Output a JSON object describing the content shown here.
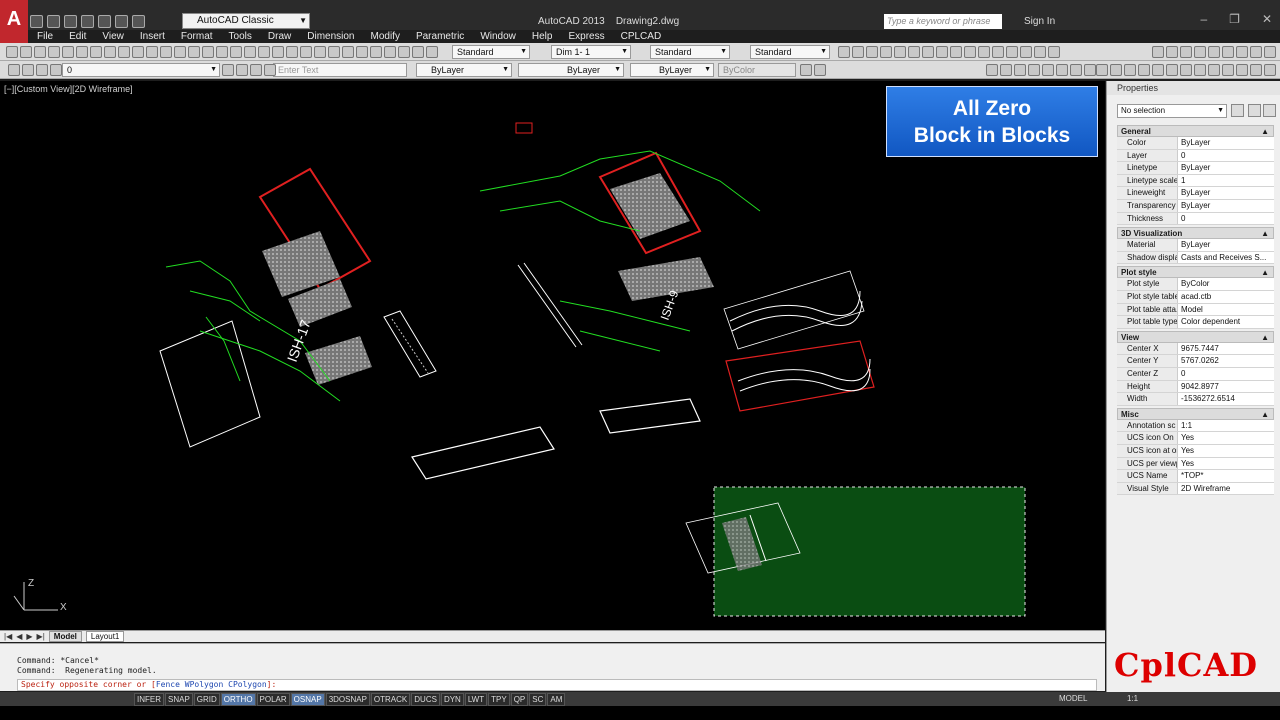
{
  "app": {
    "title": "AutoCAD 2013    Drawing2.dwg",
    "workspace": "AutoCAD Classic",
    "search_placeholder": "Type a keyword or phrase",
    "signin": "Sign In",
    "logo_letter": "A"
  },
  "menu": [
    "File",
    "Edit",
    "View",
    "Insert",
    "Format",
    "Tools",
    "Draw",
    "Dimension",
    "Modify",
    "Parametric",
    "Window",
    "Help",
    "Express",
    "CPLCAD"
  ],
  "toolbar": {
    "text_style": "Standard",
    "dim_style": "Dim 1- 1",
    "table_style": "Standard",
    "multileader_style": "Standard",
    "layer": "0",
    "enter_text_placeholder": "Enter Text",
    "color": "ByLayer",
    "linetype": "ByLayer",
    "lineweight": "ByLayer",
    "plotstyle": "ByColor"
  },
  "viewport": {
    "label": "[−][Custom View][2D Wireframe]",
    "banner_line1": "All Zero",
    "banner_line2": "Block in Blocks"
  },
  "layout_tabs": [
    "Model",
    "Layout1"
  ],
  "command": {
    "history": [
      "Command: *Cancel*",
      "Command:  Regenerating model."
    ],
    "prompt_prefix": "Specify opposite corner or [",
    "prompt_fence": "Fence",
    "prompt_wpolygon": "WPolygon",
    "prompt_cpolygon": "CPolygon",
    "prompt_suffix": "]:"
  },
  "statusbar": {
    "toggles": [
      {
        "label": "INFER",
        "on": false
      },
      {
        "label": "SNAP",
        "on": false
      },
      {
        "label": "GRID",
        "on": false
      },
      {
        "label": "ORTHO",
        "on": true
      },
      {
        "label": "POLAR",
        "on": false
      },
      {
        "label": "OSNAP",
        "on": true
      },
      {
        "label": "3DOSNAP",
        "on": false
      },
      {
        "label": "OTRACK",
        "on": false
      },
      {
        "label": "DUCS",
        "on": false
      },
      {
        "label": "DYN",
        "on": false
      },
      {
        "label": "LWT",
        "on": false
      },
      {
        "label": "TPY",
        "on": false
      },
      {
        "label": "QP",
        "on": false
      },
      {
        "label": "SC",
        "on": false
      },
      {
        "label": "AM",
        "on": false
      }
    ],
    "model": "MODEL",
    "scale": "1:1"
  },
  "properties": {
    "title": "Properties",
    "selection": "No selection",
    "sections": [
      {
        "name": "General",
        "rows": [
          [
            "Color",
            "ByLayer"
          ],
          [
            "Layer",
            "0"
          ],
          [
            "Linetype",
            "ByLayer"
          ],
          [
            "Linetype scale",
            "1"
          ],
          [
            "Lineweight",
            "ByLayer"
          ],
          [
            "Transparency",
            "ByLayer"
          ],
          [
            "Thickness",
            "0"
          ]
        ]
      },
      {
        "name": "3D Visualization",
        "rows": [
          [
            "Material",
            "ByLayer"
          ],
          [
            "Shadow display",
            "Casts and Receives S..."
          ]
        ]
      },
      {
        "name": "Plot style",
        "rows": [
          [
            "Plot style",
            "ByColor"
          ],
          [
            "Plot style table",
            "acad.ctb"
          ],
          [
            "Plot table atta...",
            "Model"
          ],
          [
            "Plot table type",
            "Color dependent"
          ]
        ]
      },
      {
        "name": "View",
        "rows": [
          [
            "Center X",
            "9675.7447"
          ],
          [
            "Center Y",
            "5767.0262"
          ],
          [
            "Center Z",
            "0"
          ],
          [
            "Height",
            "9042.8977"
          ],
          [
            "Width",
            "-1536272.6514"
          ]
        ]
      },
      {
        "name": "Misc",
        "rows": [
          [
            "Annotation sc",
            "1:1"
          ],
          [
            "UCS icon On",
            "Yes"
          ],
          [
            "UCS icon at or...",
            "Yes"
          ],
          [
            "UCS per viewp",
            "Yes"
          ],
          [
            "UCS Name",
            "*TOP*"
          ],
          [
            "Visual Style",
            "2D Wireframe"
          ]
        ]
      }
    ]
  },
  "watermark": "CplCAD",
  "colors": {
    "accent": "#2f7ee6",
    "cad_red": "#e02020",
    "cad_green": "#22dd22",
    "selection": "#0a4d12"
  }
}
